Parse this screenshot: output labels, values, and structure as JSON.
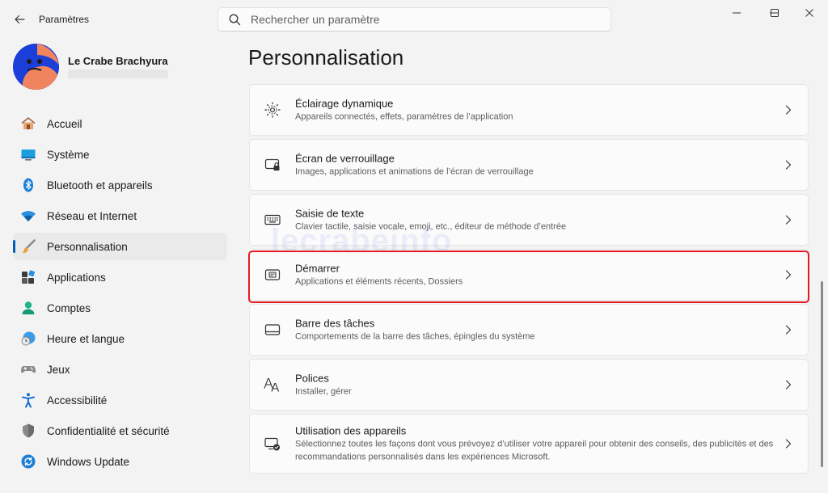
{
  "titlebar": {
    "app_title": "Paramètres",
    "search_placeholder": "Rechercher un paramètre"
  },
  "profile": {
    "name": "Le Crabe Brachyura"
  },
  "nav": {
    "items": [
      {
        "label": "Accueil",
        "icon": "home-icon"
      },
      {
        "label": "Système",
        "icon": "system-icon"
      },
      {
        "label": "Bluetooth et appareils",
        "icon": "bluetooth-icon"
      },
      {
        "label": "Réseau et Internet",
        "icon": "wifi-icon"
      },
      {
        "label": "Personnalisation",
        "icon": "brush-icon",
        "active": true
      },
      {
        "label": "Applications",
        "icon": "apps-icon"
      },
      {
        "label": "Comptes",
        "icon": "account-icon"
      },
      {
        "label": "Heure et langue",
        "icon": "clock-globe-icon"
      },
      {
        "label": "Jeux",
        "icon": "gamepad-icon"
      },
      {
        "label": "Accessibilité",
        "icon": "accessibility-icon"
      },
      {
        "label": "Confidentialité et sécurité",
        "icon": "shield-icon"
      },
      {
        "label": "Windows Update",
        "icon": "update-icon"
      }
    ]
  },
  "main": {
    "title": "Personnalisation",
    "cards": [
      {
        "title": "Éclairage dynamique",
        "subtitle": "Appareils connectés, effets, paramètres de l’application",
        "icon": "dynamic-lighting-icon"
      },
      {
        "title": "Écran de verrouillage",
        "subtitle": "Images, applications et animations de l’écran de verrouillage",
        "icon": "lock-screen-icon"
      },
      {
        "title": "Saisie de texte",
        "subtitle": "Clavier tactile, saisie vocale, emoji, etc., éditeur de méthode d’entrée",
        "icon": "keyboard-icon"
      },
      {
        "title": "Démarrer",
        "subtitle": "Applications et éléments récents, Dossiers",
        "icon": "start-icon"
      },
      {
        "title": "Barre des tâches",
        "subtitle": "Comportements de la barre des tâches, épingles du système",
        "icon": "taskbar-icon"
      },
      {
        "title": "Polices",
        "subtitle": "Installer, gérer",
        "icon": "fonts-icon"
      },
      {
        "title": "Utilisation des appareils",
        "subtitle": "Sélectionnez toutes les façons dont vous prévoyez d’utiliser votre appareil pour obtenir des conseils, des publicités et des recommandations personnalisés dans les expériences Microsoft.",
        "icon": "device-usage-icon"
      }
    ]
  },
  "watermark": "lecrabeinfo",
  "colors": {
    "accent": "#005fb8",
    "highlight": "#e31b23",
    "background": "#f3f3f3",
    "card": "#fbfbfb"
  }
}
